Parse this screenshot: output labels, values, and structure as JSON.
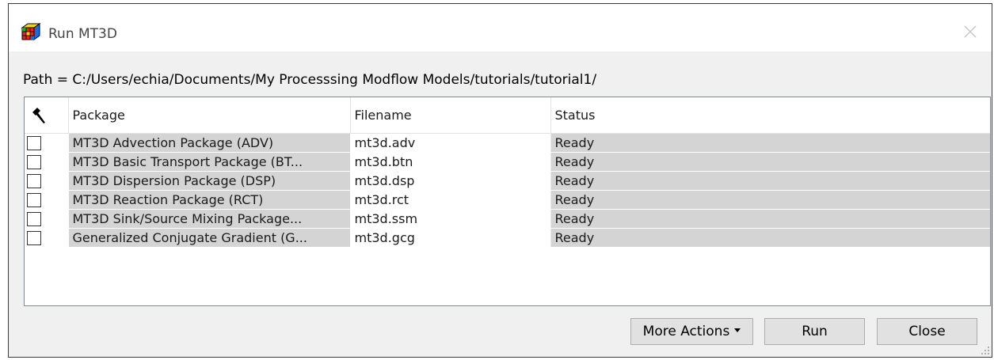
{
  "window": {
    "title": "Run MT3D",
    "icon": "mt3d-app-icon",
    "close_icon": "close-icon"
  },
  "path_label": "Path = C:/Users/echia/Documents/My Processsing Modflow Models/tutorials/tutorial1/",
  "table": {
    "header_icon": "hammer-icon",
    "columns": [
      "Package",
      "Filename",
      "Status"
    ],
    "rows": [
      {
        "checked": false,
        "package": "MT3D Advection Package (ADV)",
        "filename": "mt3d.adv",
        "status": "Ready"
      },
      {
        "checked": false,
        "package": "MT3D Basic Transport Package (BT...",
        "filename": "mt3d.btn",
        "status": "Ready"
      },
      {
        "checked": false,
        "package": "MT3D Dispersion Package (DSP)",
        "filename": "mt3d.dsp",
        "status": "Ready"
      },
      {
        "checked": false,
        "package": "MT3D Reaction Package (RCT)",
        "filename": "mt3d.rct",
        "status": "Ready"
      },
      {
        "checked": false,
        "package": "MT3D Sink/Source Mixing Package...",
        "filename": "mt3d.ssm",
        "status": "Ready"
      },
      {
        "checked": false,
        "package": "Generalized Conjugate Gradient (G...",
        "filename": "mt3d.gcg",
        "status": "Ready"
      }
    ]
  },
  "buttons": {
    "more_actions": "More Actions",
    "run": "Run",
    "close": "Close"
  },
  "colors": {
    "window_bg": "#f0f0f0",
    "highlight_cell": "#d4d4d4"
  }
}
